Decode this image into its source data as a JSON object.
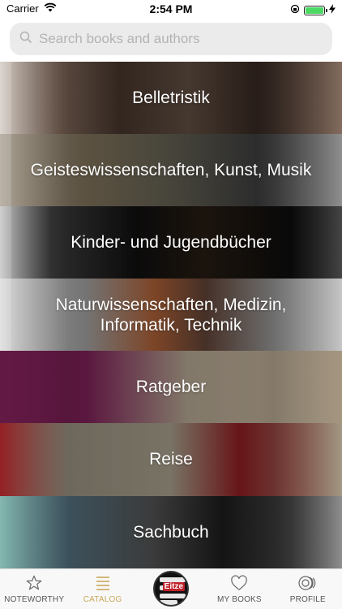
{
  "status_bar": {
    "carrier": "Carrier",
    "time": "2:54 PM"
  },
  "search": {
    "placeholder": "Search books and authors",
    "value": ""
  },
  "categories": [
    {
      "label": "Belletristik"
    },
    {
      "label": "Geisteswissenschaften, Kunst, Musik"
    },
    {
      "label": "Kinder- und Jugendbücher"
    },
    {
      "label": "Naturwissenschaften, Medizin, Informatik, Technik"
    },
    {
      "label": "Ratgeber"
    },
    {
      "label": "Reise"
    },
    {
      "label": "Sachbuch"
    }
  ],
  "tabbar": {
    "tabs": [
      {
        "label": "NOTEWORTHY",
        "icon": "star-icon"
      },
      {
        "label": "CATALOG",
        "icon": "catalog-icon",
        "active": true
      },
      {
        "label": "",
        "icon": "eitze-logo"
      },
      {
        "label": "MY BOOKS",
        "icon": "heart-icon"
      },
      {
        "label": "PROFILE",
        "icon": "profile-icon"
      }
    ],
    "center_logo_text": "Eitze"
  },
  "colors": {
    "active_tab": "#c8a95a",
    "battery": "#4cd964"
  }
}
